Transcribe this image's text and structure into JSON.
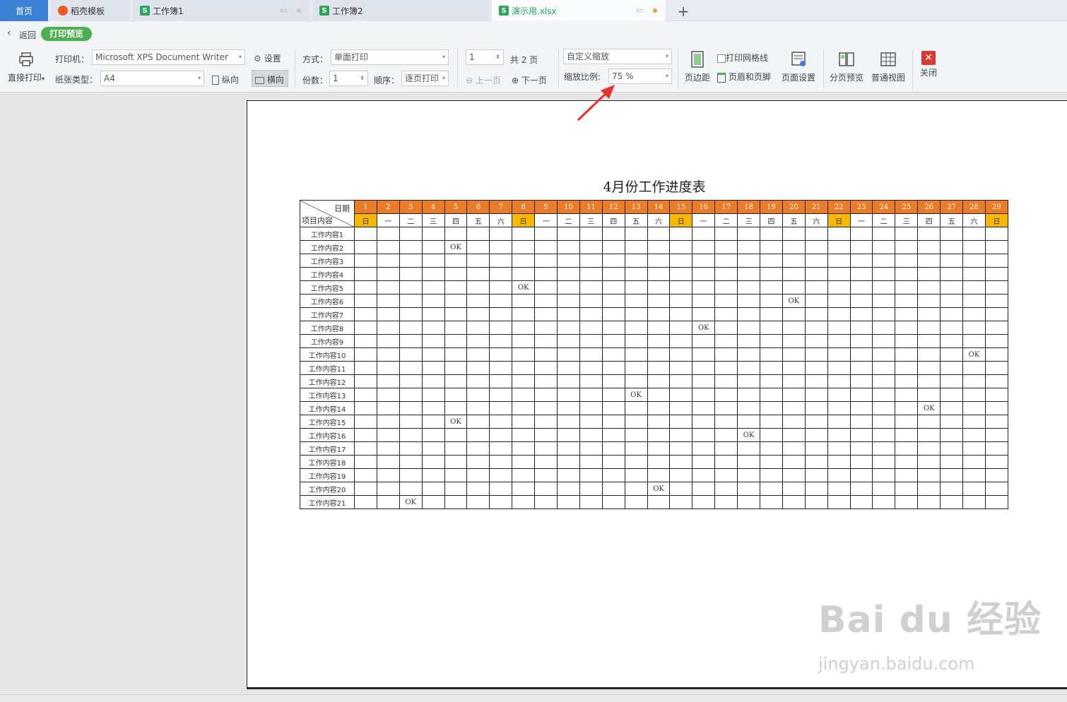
{
  "tabs": [
    {
      "label": "首页"
    },
    {
      "label": "稻壳模板"
    },
    {
      "label": "工作簿1"
    },
    {
      "label": "工作簿2"
    },
    {
      "label": "演示用.xlsx"
    }
  ],
  "toolbar": {
    "back_label": "返回",
    "mode_badge": "打印预览",
    "direct_print": "直接打印",
    "printer_label": "打印机：",
    "printer_value": "Microsoft XPS Document Writer",
    "settings_label": "设置",
    "paper_label": "纸张类型：",
    "paper_value": "A4",
    "portrait": "纵向",
    "landscape": "横向",
    "mode_label": "方式：",
    "mode_value": "单面打印",
    "copies_label": "份数：",
    "copies_value": "1",
    "order_label": "顺序：",
    "order_value": "逐页打印",
    "page_value": "1",
    "page_total": "共 2 页",
    "prev_page": "上一页",
    "next_page": "下一页",
    "zoom_mode": "自定义缩放",
    "zoom_label": "缩放比例:",
    "zoom_value": "75 %",
    "margins": "页边距",
    "print_grid": "打印网格线",
    "header_footer": "页眉和页脚",
    "page_setup": "页面设置",
    "page_break": "分页预览",
    "normal_view": "普通视图",
    "close": "关闭"
  },
  "sheet": {
    "title": "4月份工作进度表",
    "corner_top": "日期",
    "corner_bottom": "项目内容",
    "days": [
      "1",
      "2",
      "3",
      "4",
      "5",
      "6",
      "7",
      "8",
      "9",
      "10",
      "11",
      "12",
      "13",
      "14",
      "15",
      "16",
      "17",
      "18",
      "19",
      "20",
      "21",
      "22",
      "23",
      "24",
      "25",
      "26",
      "27",
      "28",
      "29"
    ],
    "weekdays": [
      "日",
      "一",
      "二",
      "三",
      "四",
      "五",
      "六",
      "日",
      "一",
      "二",
      "三",
      "四",
      "五",
      "六",
      "日",
      "一",
      "二",
      "三",
      "四",
      "五",
      "六",
      "日",
      "一",
      "二",
      "三",
      "四",
      "五",
      "六",
      "日"
    ],
    "rows": [
      {
        "label": "工作内容1",
        "ok_day": 0
      },
      {
        "label": "工作内容2",
        "ok_day": 5
      },
      {
        "label": "工作内容3",
        "ok_day": 0
      },
      {
        "label": "工作内容4",
        "ok_day": 0
      },
      {
        "label": "工作内容5",
        "ok_day": 8
      },
      {
        "label": "工作内容6",
        "ok_day": 20
      },
      {
        "label": "工作内容7",
        "ok_day": 0
      },
      {
        "label": "工作内容8",
        "ok_day": 16
      },
      {
        "label": "工作内容9",
        "ok_day": 0
      },
      {
        "label": "工作内容10",
        "ok_day": 28
      },
      {
        "label": "工作内容11",
        "ok_day": 0
      },
      {
        "label": "工作内容12",
        "ok_day": 0
      },
      {
        "label": "工作内容13",
        "ok_day": 13
      },
      {
        "label": "工作内容14",
        "ok_day": 26
      },
      {
        "label": "工作内容15",
        "ok_day": 5
      },
      {
        "label": "工作内容16",
        "ok_day": 18
      },
      {
        "label": "工作内容17",
        "ok_day": 0
      },
      {
        "label": "工作内容18",
        "ok_day": 0
      },
      {
        "label": "工作内容19",
        "ok_day": 0
      },
      {
        "label": "工作内容20",
        "ok_day": 14
      },
      {
        "label": "工作内容21",
        "ok_day": 3
      }
    ],
    "ok_text": "OK"
  },
  "colors": {
    "day_header": "#e97c28",
    "sunday": "#f6b800",
    "accent_green": "#4caf50",
    "home_tab": "#3b82d6",
    "arrow": "#e8312a"
  },
  "watermark": {
    "brand": "Bai du 经验",
    "url": "jingyan.baidu.com"
  }
}
